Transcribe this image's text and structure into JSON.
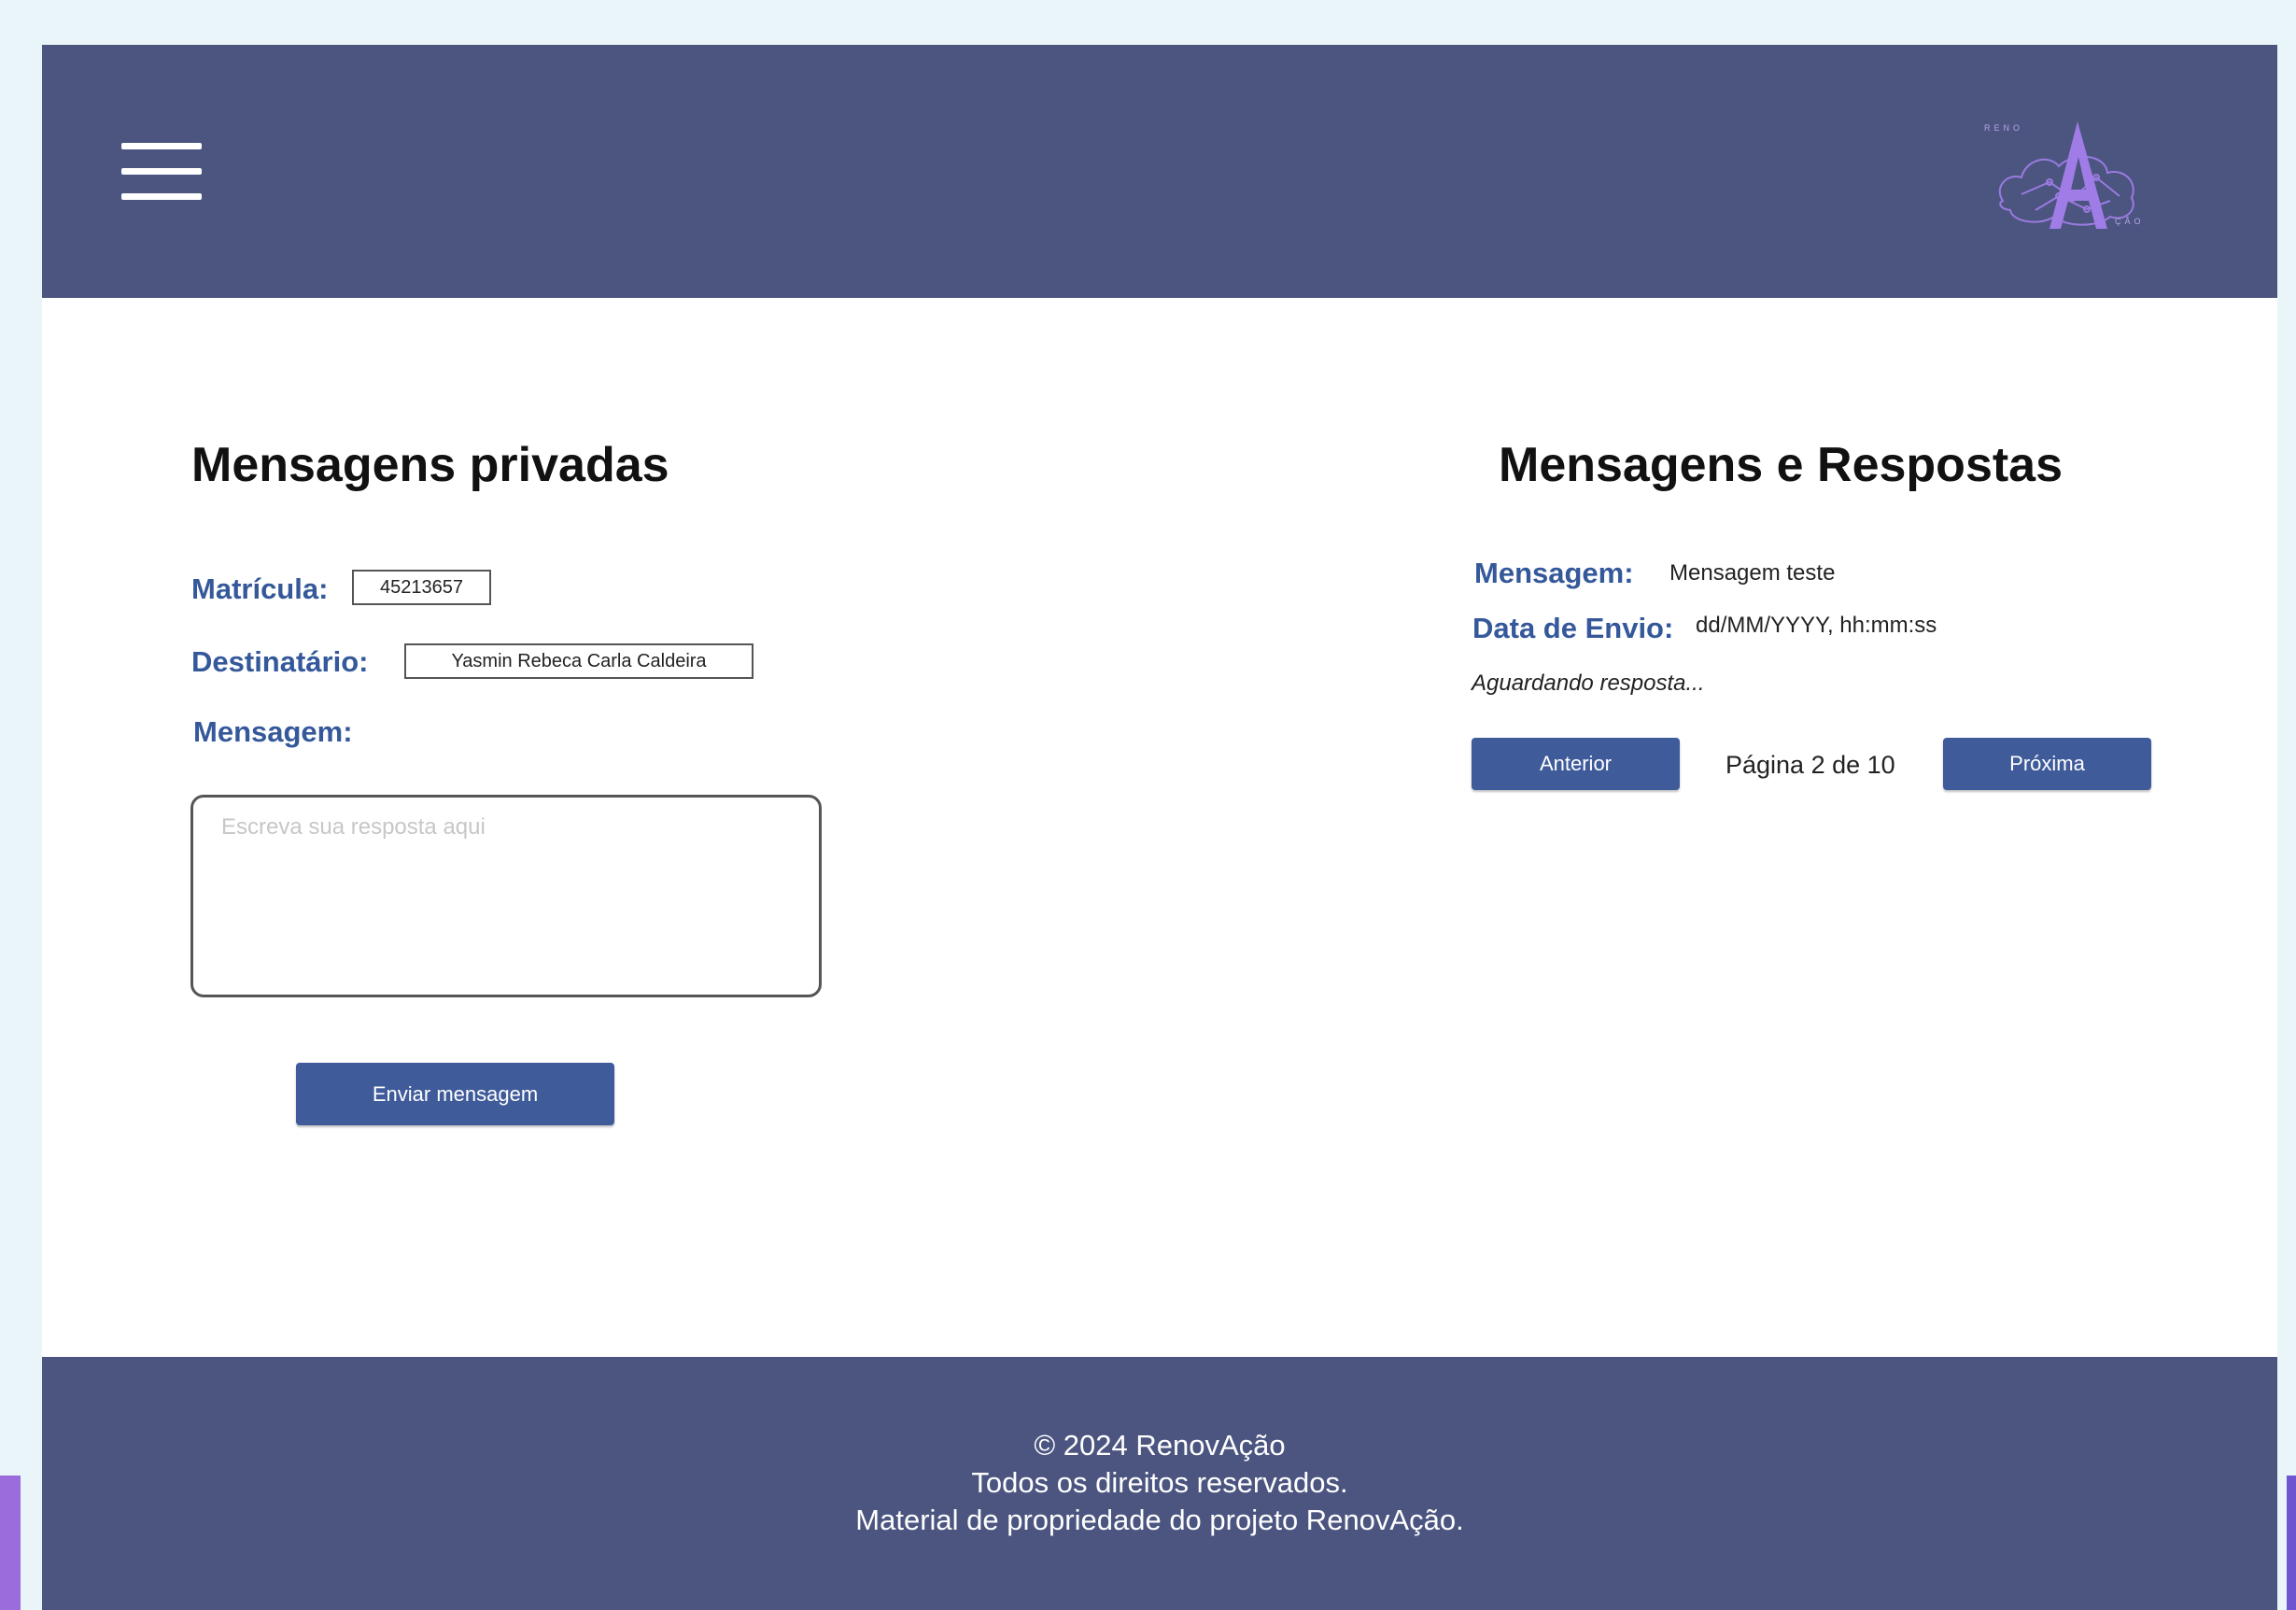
{
  "header": {
    "menu_icon": "hamburger-menu-icon",
    "logo_icon": "renovacao-logo-icon",
    "logo_text": "RENOVAÇÃO"
  },
  "private_messages": {
    "title": "Mensagens privadas",
    "matricula_label": "Matrícula:",
    "matricula_value": "45213657",
    "destinatario_label": "Destinatário:",
    "destinatario_value": "Yasmin Rebeca Carla Caldeira",
    "mensagem_label": "Mensagem:",
    "mensagem_placeholder": "Escreva sua resposta aqui",
    "mensagem_value": "",
    "send_button": "Enviar mensagem"
  },
  "messages_replies": {
    "title": "Mensagens e Respostas",
    "mensagem_label": "Mensagem:",
    "mensagem_value": "Mensagem teste",
    "data_envio_label": "Data de Envio:",
    "data_envio_value": "dd/MM/YYYY, hh:mm:ss",
    "status": "Aguardando resposta...",
    "prev_button": "Anterior",
    "page_indicator": "Página 2 de 10",
    "next_button": "Próxima"
  },
  "footer": {
    "line1": "© 2024 RenovAção",
    "line2": "Todos os direitos reservados.",
    "line3": "Material de propriedade do projeto RenovAção."
  },
  "colors": {
    "header_bg": "#4b5580",
    "accent_blue": "#3f5b9a",
    "label_blue": "#34589a",
    "page_bg": "#eaf5fa",
    "logo_purple": "#9b7ae0"
  }
}
